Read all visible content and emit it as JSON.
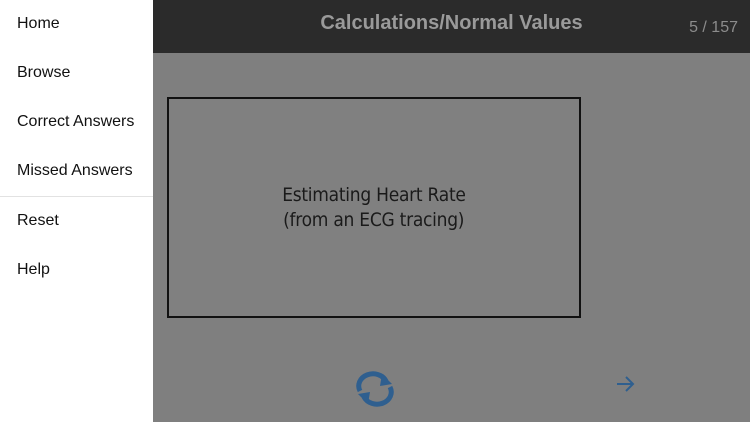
{
  "header": {
    "title": "Calculations/Normal Values",
    "counter": "5 / 157"
  },
  "card": {
    "line1": "Estimating Heart Rate",
    "line2": "(from an ECG tracing)"
  },
  "controls": {
    "flip_icon": "refresh-icon",
    "next_icon": "arrow-right-icon",
    "accent_color": "#2f5f8f"
  },
  "menu": {
    "items": [
      {
        "label": "Home"
      },
      {
        "label": "Browse"
      },
      {
        "label": "Correct Answers"
      },
      {
        "label": "Missed Answers"
      },
      {
        "label": "Reset"
      },
      {
        "label": "Help"
      }
    ]
  }
}
